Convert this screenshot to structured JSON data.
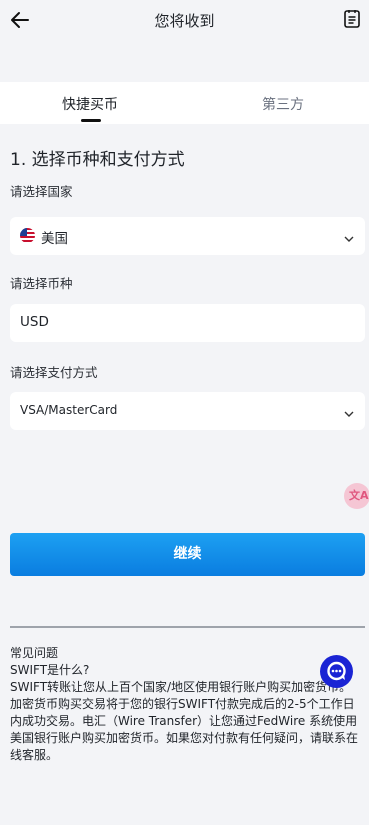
{
  "header": {
    "title": "您将收到",
    "back_icon": "arrow-left-icon",
    "orders_icon": "document-list-icon"
  },
  "tabs": [
    {
      "label": "快捷买币",
      "active": true
    },
    {
      "label": "第三方",
      "active": false
    }
  ],
  "form": {
    "section_title": "1. 选择币种和支付方式",
    "country": {
      "label": "请选择国家",
      "value": "美国",
      "flag": "us-flag-icon"
    },
    "currency": {
      "label": "请选择币种",
      "value": "USD"
    },
    "payment": {
      "label": "请选择支付方式",
      "value": "VSA/MasterCard"
    }
  },
  "continue_label": "继续",
  "translate_label": "文A",
  "faq": {
    "title": "常见问题",
    "question": "SWIFT是什么?",
    "answer": "SWIFT转账让您从上百个国家/地区使用银行账户购买加密货币。加密货币购买交易将于您的银行SWIFT付款完成后的2-5个工作日内成功交易。电汇（Wire Transfer）让您通过FedWire 系统使用美国银行账户购买加密货币。如果您对付款有任何疑问，请联系在线客服。"
  },
  "colors": {
    "accent": "#0a7de0",
    "chat": "#1a24d4",
    "background": "#f3f4f7"
  }
}
